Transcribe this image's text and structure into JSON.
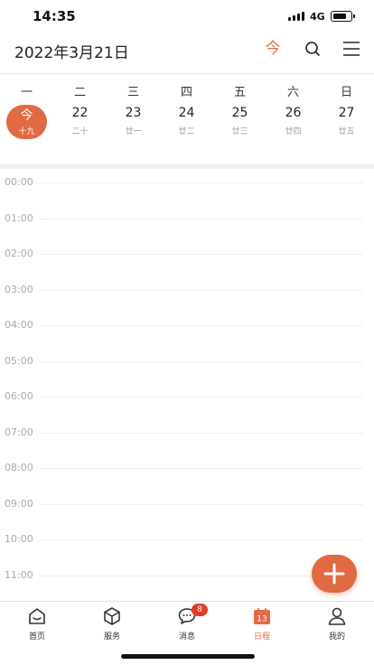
{
  "status_bar": {
    "time": "14:35",
    "network": "4G"
  },
  "header": {
    "date_title": "2022年3月21日",
    "today_label": "今"
  },
  "week": [
    {
      "weekday": "一",
      "day": "今",
      "lunar": "十九",
      "today": true
    },
    {
      "weekday": "二",
      "day": "22",
      "lunar": "二十",
      "today": false
    },
    {
      "weekday": "三",
      "day": "23",
      "lunar": "廿一",
      "today": false
    },
    {
      "weekday": "四",
      "day": "24",
      "lunar": "廿二",
      "today": false
    },
    {
      "weekday": "五",
      "day": "25",
      "lunar": "廿三",
      "today": false
    },
    {
      "weekday": "六",
      "day": "26",
      "lunar": "廿四",
      "today": false
    },
    {
      "weekday": "日",
      "day": "27",
      "lunar": "廿五",
      "today": false
    }
  ],
  "hours": [
    "00:00",
    "01:00",
    "02:00",
    "03:00",
    "04:00",
    "05:00",
    "06:00",
    "07:00",
    "08:00",
    "09:00",
    "10:00",
    "11:00"
  ],
  "tabbar": {
    "items": [
      {
        "label": "首页",
        "icon": "home-icon"
      },
      {
        "label": "服务",
        "icon": "box-icon"
      },
      {
        "label": "消息",
        "icon": "chat-icon",
        "badge": "8"
      },
      {
        "label": "日程",
        "icon": "calendar-icon",
        "calendar_number": "13",
        "active": true
      },
      {
        "label": "我的",
        "icon": "user-icon"
      }
    ]
  },
  "colors": {
    "accent": "#e06a44",
    "badge": "#e33b2e"
  }
}
